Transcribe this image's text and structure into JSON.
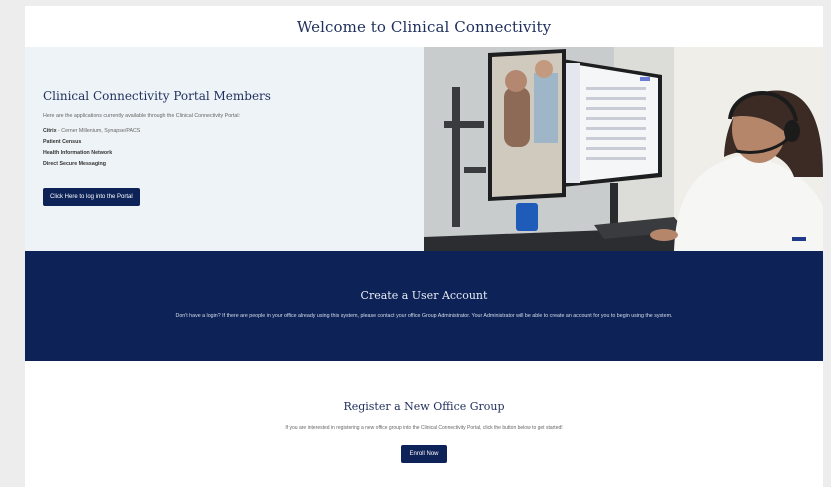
{
  "header": {
    "title": "Welcome to Clinical Connectivity"
  },
  "members": {
    "title": "Clinical Connectivity Portal Members",
    "intro": "Here are the applications currently available through the Clinical Connectivity Portal:",
    "apps": [
      {
        "name": "Citrix",
        "detail": " - Cerner Millenium, Synapse/PACS"
      },
      {
        "name": "Patient Census",
        "detail": ""
      },
      {
        "name": "Health Information Network",
        "detail": ""
      },
      {
        "name": "Direct Secure Messaging",
        "detail": ""
      }
    ],
    "login_button": "Click Here to log into the Portal"
  },
  "hero_image": {
    "description_icon": "clinician-telehealth-photo"
  },
  "create_account": {
    "title": "Create a User Account",
    "text": "Don't have a login? If there are people in your office already using this system, please contact your office Group Administrator. Your Administrator will be able to create an account for you to begin using the system."
  },
  "register": {
    "title": "Register a New Office Group",
    "text": "If you are interested in registering a new office group into the Clinical Connectivity Portal, click the button below to get started!",
    "enroll_button": "Enroll Now"
  },
  "colors": {
    "navy": "#0d2257",
    "title_blue": "#1f2f5c",
    "hero_left_bg": "#eef3f7",
    "page_bg": "#ededed"
  }
}
